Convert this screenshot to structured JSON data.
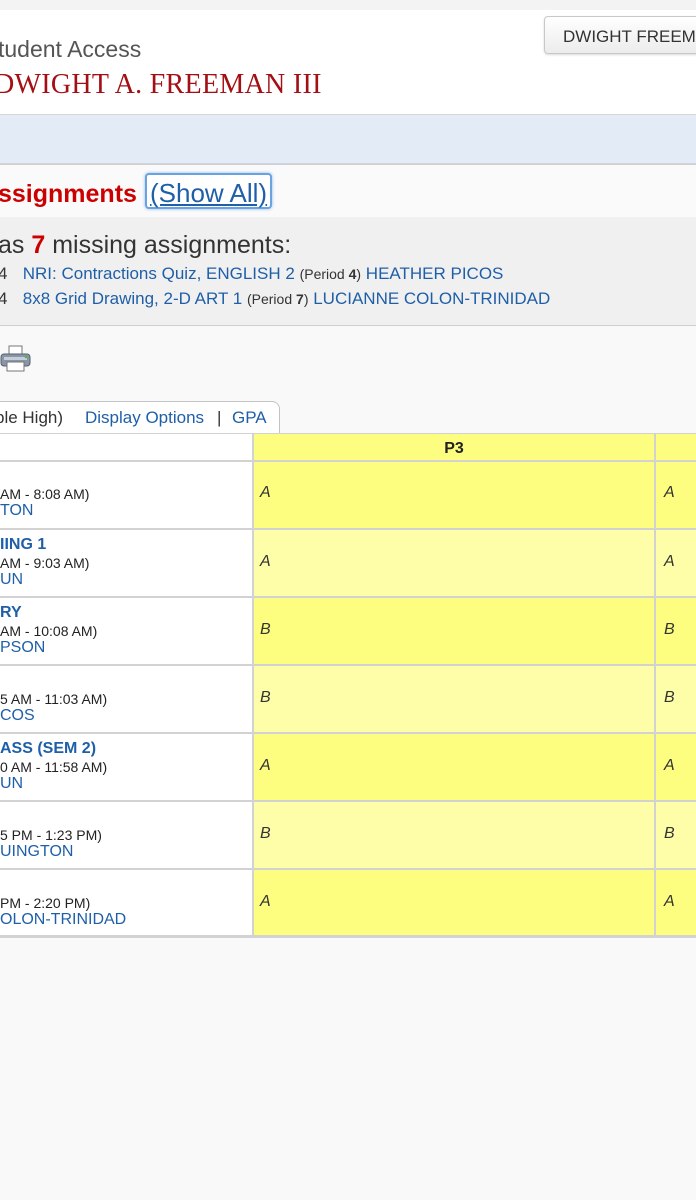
{
  "header": {
    "app_title": "tudent Access",
    "student_name": "DWIGHT A. FREEMAN III",
    "user_button": "DWIGHT FREEMA"
  },
  "assignments": {
    "title": "ssignments",
    "show_all": "(Show All)",
    "summary_prefix": "as ",
    "missing_count": "7",
    "summary_suffix": " missing assignments:",
    "items": [
      {
        "num": "4",
        "name": "NRI: Contractions Quiz, ENGLISH 2",
        "period_label": "(Period ",
        "period": "4",
        "period_close": ")",
        "teacher": "HEATHER PICOS"
      },
      {
        "num": "4",
        "name": "8x8 Grid Drawing, 2-D ART 1",
        "period_label": "(Period ",
        "period": "7",
        "period_close": ")",
        "teacher": "LUCIANNE COLON-TRINIDAD"
      }
    ]
  },
  "tabs": {
    "school": "ble High)",
    "display_options": "Display Options",
    "separator": "|",
    "gpa": "GPA"
  },
  "grid": {
    "header_col": "P3",
    "rows": [
      {
        "course": "",
        "time": "AM - 8:08 AM)",
        "teacher": "TON",
        "p3": "A",
        "p4": "A"
      },
      {
        "course": "IING 1",
        "time": "AM - 9:03 AM)",
        "teacher": "UN",
        "p3": "A",
        "p4": "A"
      },
      {
        "course": "RY",
        "time": "AM - 10:08 AM)",
        "teacher": "PSON",
        "p3": "B",
        "p4": "B"
      },
      {
        "course": "",
        "time": "5 AM - 11:03 AM)",
        "teacher": "COS",
        "p3": "B",
        "p4": "B"
      },
      {
        "course": "ASS (SEM 2)",
        "time": "0 AM - 11:58 AM)",
        "teacher": "UN",
        "p3": "A",
        "p4": "A"
      },
      {
        "course": "",
        "time": "5 PM - 1:23 PM)",
        "teacher": "UINGTON",
        "p3": "B",
        "p4": "B"
      },
      {
        "course": "",
        "time": "PM - 2:20 PM)",
        "teacher": "OLON-TRINIDAD",
        "p3": "A",
        "p4": "A"
      }
    ]
  },
  "colors": {
    "name_red": "#a30f14",
    "alert_red": "#cc0000",
    "link_blue": "#1f5fa8",
    "grade_yellow": "#fdfd80",
    "grade_light_yellow": "#fefea8"
  }
}
